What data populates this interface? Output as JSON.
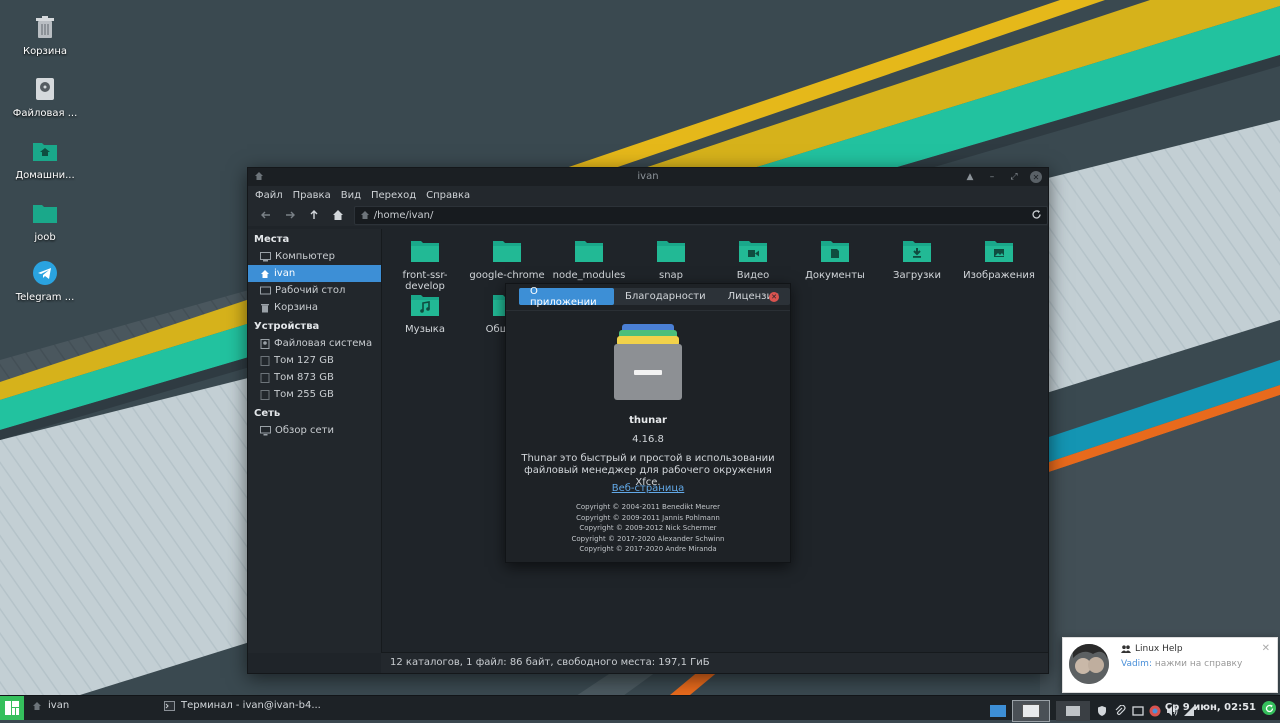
{
  "desktop": {
    "icons": [
      {
        "label": "Корзина",
        "icon": "trash-icon"
      },
      {
        "label": "Файловая ...",
        "icon": "drive-icon"
      },
      {
        "label": "Домашни...",
        "icon": "home-folder-icon"
      },
      {
        "label": "joob",
        "icon": "folder-icon"
      },
      {
        "label": "Telegram ...",
        "icon": "telegram-icon"
      }
    ]
  },
  "window": {
    "title": "ivan",
    "menu": [
      "Файл",
      "Правка",
      "Вид",
      "Переход",
      "Справка"
    ],
    "path": "/home/ivan/",
    "sidebar": {
      "sections": [
        {
          "title": "Места",
          "items": [
            {
              "label": "Компьютер",
              "icon": "computer-icon"
            },
            {
              "label": "ivan",
              "icon": "home-icon",
              "active": true
            },
            {
              "label": "Рабочий стол",
              "icon": "desktop-icon"
            },
            {
              "label": "Корзина",
              "icon": "trash-icon"
            }
          ]
        },
        {
          "title": "Устройства",
          "items": [
            {
              "label": "Файловая система",
              "icon": "drive-icon"
            },
            {
              "label": "Том 127 GB",
              "icon": "drive-icon"
            },
            {
              "label": "Том 873 GB",
              "icon": "drive-icon"
            },
            {
              "label": "Том 255 GB",
              "icon": "drive-icon"
            }
          ]
        },
        {
          "title": "Сеть",
          "items": [
            {
              "label": "Обзор сети",
              "icon": "network-icon"
            }
          ]
        }
      ]
    },
    "files": [
      {
        "label": "front-ssr-develop",
        "icon": "folder-icon"
      },
      {
        "label": "google-chrome",
        "icon": "folder-icon"
      },
      {
        "label": "node_modules",
        "icon": "folder-icon"
      },
      {
        "label": "snap",
        "icon": "folder-icon"
      },
      {
        "label": "Видео",
        "icon": "video-folder-icon"
      },
      {
        "label": "Документы",
        "icon": "documents-folder-icon"
      },
      {
        "label": "Загрузки",
        "icon": "download-folder-icon"
      },
      {
        "label": "Изображения",
        "icon": "pictures-folder-icon"
      },
      {
        "label": "Музыка",
        "icon": "music-folder-icon"
      },
      {
        "label": "Общедо",
        "icon": "folder-icon"
      }
    ],
    "status": "12 каталогов, 1 файл: 86 байт, свободного места: 197,1 ГиБ"
  },
  "about": {
    "tabs": [
      "О приложении",
      "Благодарности",
      "Лицензия"
    ],
    "app_name": "thunar",
    "version": "4.16.8",
    "description": "Thunar это быстрый и простой в использовании файловый менеджер для рабочего окружения Xfce.",
    "link": "Веб-страница",
    "copyright": [
      "Copyright © 2004-2011 Benedikt Meurer",
      "Copyright © 2009-2011 Jannis Pohlmann",
      "Copyright © 2009-2012 Nick Schermer",
      "Copyright © 2017-2020 Alexander Schwinn",
      "Copyright © 2017-2020 Andre Miranda"
    ]
  },
  "taskbar": {
    "tasks": [
      "ivan",
      "Терминал - ivan@ivan-b4..."
    ],
    "clock": "Ср 9 июн, 02:51"
  },
  "notification": {
    "title": "Linux Help",
    "sender": "Vadim:",
    "message": "нажми на справку"
  },
  "colors": {
    "accent": "#3d8fd6",
    "folder": "#1aa88a",
    "manjaro": "#35bf5c"
  }
}
